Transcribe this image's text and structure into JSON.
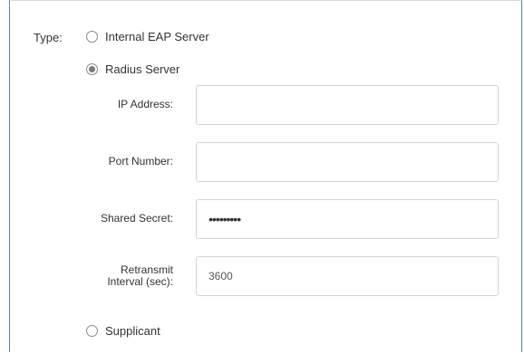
{
  "form": {
    "type_label": "Type:",
    "options": {
      "internal_eap": {
        "label": "Internal EAP Server",
        "checked": false
      },
      "radius": {
        "label": "Radius Server",
        "checked": true
      },
      "supplicant": {
        "label": "Supplicant",
        "checked": false
      }
    },
    "fields": {
      "ip_address": {
        "label": "IP Address:",
        "value": ""
      },
      "port_number": {
        "label": "Port Number:",
        "value": ""
      },
      "shared_secret": {
        "label": "Shared Secret:",
        "value": "•••••••••"
      },
      "retransmit": {
        "label_line1": "Retransmit",
        "label_line2": "Interval (sec):",
        "value": "3600"
      }
    }
  }
}
